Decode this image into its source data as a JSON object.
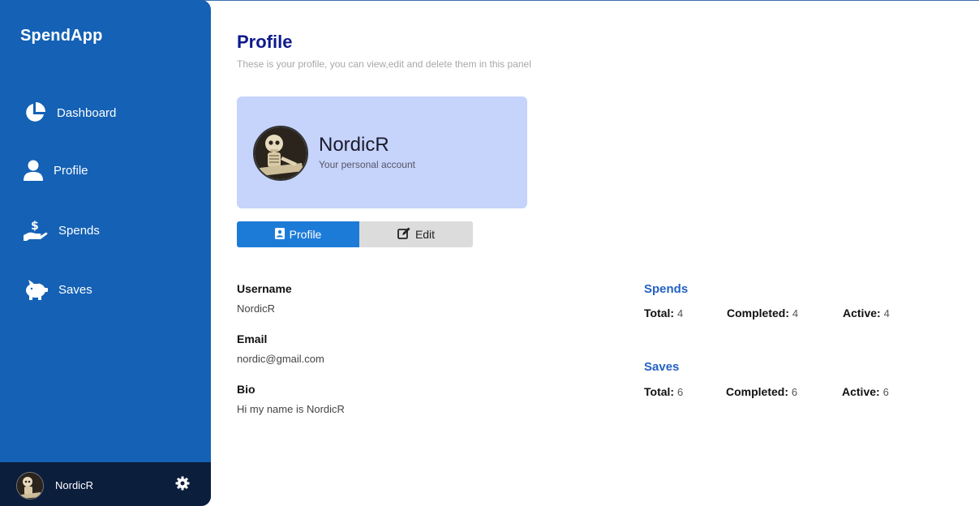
{
  "app": {
    "brand": "SpendApp"
  },
  "sidebar": {
    "items": [
      {
        "label": "Dashboard",
        "icon": "pie-chart-icon"
      },
      {
        "label": "Profile",
        "icon": "user-icon"
      },
      {
        "label": "Spends",
        "icon": "hand-dollar-icon"
      },
      {
        "label": "Saves",
        "icon": "piggy-bank-icon"
      }
    ],
    "footer": {
      "username": "NordicR",
      "settings_icon": "gear-icon"
    }
  },
  "header": {
    "title": "Profile",
    "subtitle": "These is your profile, you can view,edit and delete them in this panel"
  },
  "profile_card": {
    "name": "NordicR",
    "subtitle": "Your personal account"
  },
  "tabs": [
    {
      "label": "Profile",
      "icon": "contact-card-icon",
      "active": true
    },
    {
      "label": "Edit",
      "icon": "edit-icon",
      "active": false
    }
  ],
  "fields": {
    "username": {
      "label": "Username",
      "value": "NordicR"
    },
    "email": {
      "label": "Email",
      "value": "nordic@gmail.com"
    },
    "bio": {
      "label": "Bio",
      "value": "Hi my name is NordicR"
    }
  },
  "stats": {
    "spends": {
      "title": "Spends",
      "total_label": "Total:",
      "total": "4",
      "completed_label": "Completed:",
      "completed": "4",
      "active_label": "Active:",
      "active": "4"
    },
    "saves": {
      "title": "Saves",
      "total_label": "Total:",
      "total": "6",
      "completed_label": "Completed:",
      "completed": "6",
      "active_label": "Active:",
      "active": "6"
    }
  },
  "colors": {
    "sidebar": "#1461b5",
    "footer": "#0b1e3c",
    "title": "#0d1a8c",
    "card": "#c6d3fb",
    "active_tab": "#1d7bd8",
    "stat_title": "#2461c4"
  }
}
